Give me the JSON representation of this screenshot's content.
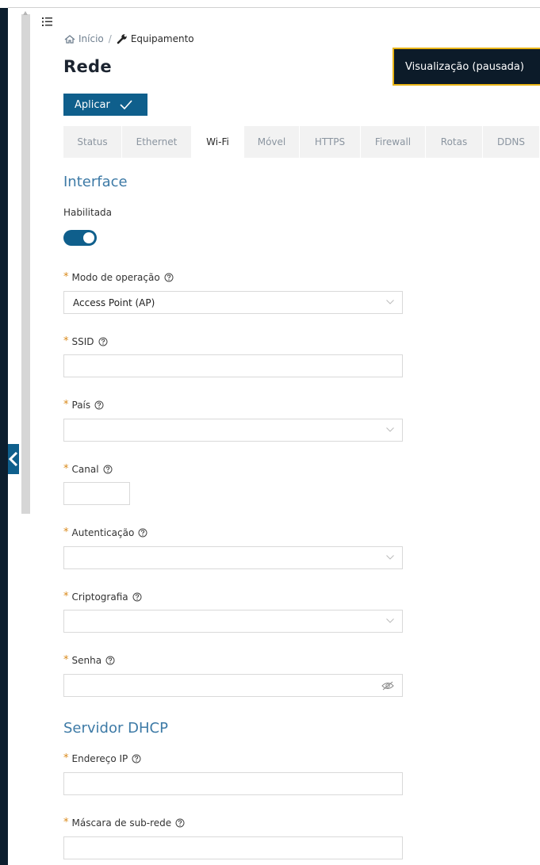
{
  "breadcrumb": {
    "home": "Início",
    "separator": "/",
    "current": "Equipamento"
  },
  "page": {
    "title": "Rede"
  },
  "toolbar": {
    "apply_label": "Aplicar"
  },
  "toast": {
    "text": "Visualização (pausada)"
  },
  "tabs": [
    {
      "label": "Status",
      "active": false
    },
    {
      "label": "Ethernet",
      "active": false
    },
    {
      "label": "Wi-Fi",
      "active": true
    },
    {
      "label": "Móvel",
      "active": false
    },
    {
      "label": "HTTPS",
      "active": false
    },
    {
      "label": "Firewall",
      "active": false
    },
    {
      "label": "Rotas",
      "active": false
    },
    {
      "label": "DDNS",
      "active": false
    }
  ],
  "interface": {
    "title": "Interface",
    "enabled_label": "Habilitada",
    "enabled": true,
    "mode": {
      "label": "Modo de operação",
      "value": "Access Point (AP)"
    },
    "ssid": {
      "label": "SSID",
      "value": ""
    },
    "country": {
      "label": "País",
      "value": ""
    },
    "channel": {
      "label": "Canal",
      "value": ""
    },
    "auth": {
      "label": "Autenticação",
      "value": ""
    },
    "crypto": {
      "label": "Criptografia",
      "value": ""
    },
    "password": {
      "label": "Senha",
      "value": ""
    }
  },
  "dhcp": {
    "title": "Servidor DHCP",
    "ip": {
      "label": "Endereço IP",
      "value": ""
    },
    "mask": {
      "label": "Máscara de sub-rede",
      "value": ""
    }
  },
  "colors": {
    "primary": "#0f5f8c",
    "required": "#d9891a",
    "section": "#3d7aa6",
    "toast_border": "#e8b416",
    "sidebar": "#0c1e2e"
  },
  "icons": [
    "menu-icon",
    "home-icon",
    "wrench-icon",
    "check-icon",
    "help-icon",
    "chevron-down-icon",
    "eye-off-icon",
    "chevron-left-icon"
  ]
}
